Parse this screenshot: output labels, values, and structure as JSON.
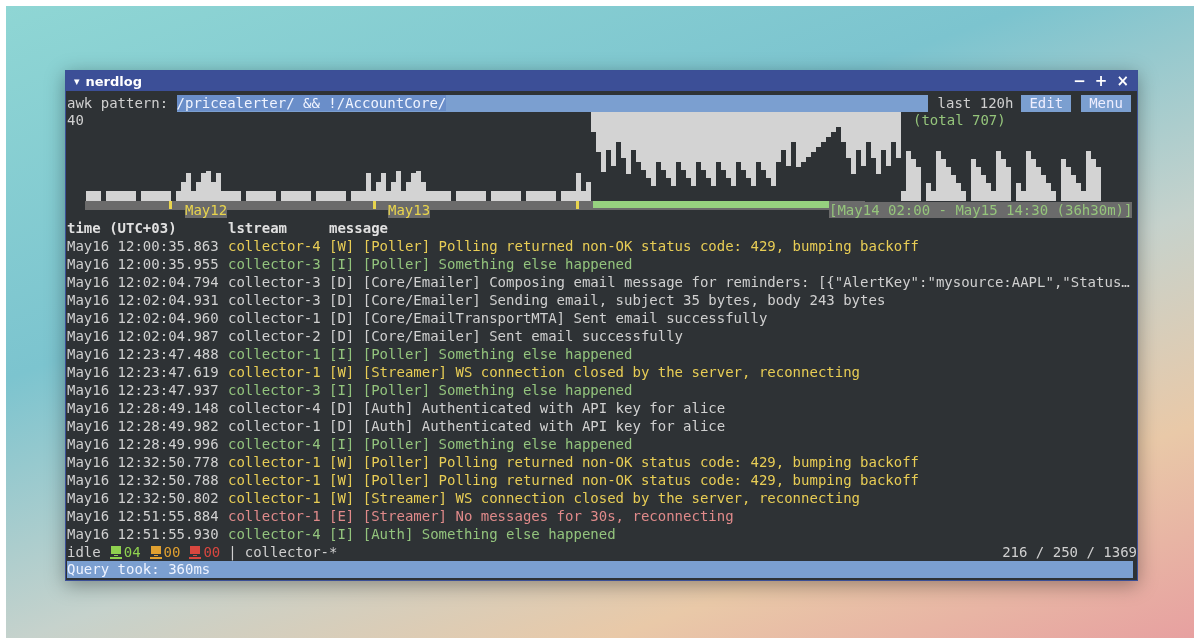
{
  "window": {
    "menu_glyph": "▾",
    "title": "nerdlog",
    "controls": [
      "−",
      "+",
      "×"
    ]
  },
  "query": {
    "label": "awk pattern:",
    "value": "/pricealerter/ && !/AccountCore/",
    "period": "last 120h",
    "buttons": [
      "Edit",
      "Menu"
    ]
  },
  "histogram": {
    "max_label": "40",
    "total": "(total 707)",
    "day_labels": [
      "May12",
      "May13"
    ],
    "selection": "[May14 02:00 - May15 14:30 (36h30m)]"
  },
  "columns": [
    "time (UTC+03)",
    "lstream",
    "message"
  ],
  "rows": [
    {
      "time": "May16 12:00:35.863",
      "lstream": "collector-4",
      "tag": "[W]",
      "message": "[Poller] Polling returned non-OK status code: 429, bumping backoff",
      "kind": "warning"
    },
    {
      "time": "May16 12:00:35.955",
      "lstream": "collector-3",
      "tag": "[I]",
      "message": "[Poller] Something else happened",
      "kind": "info"
    },
    {
      "time": "May16 12:02:04.794",
      "lstream": "collector-3",
      "tag": "[D]",
      "message": "[Core/Emailer] Composing email message for reminders: [{\"AlertKey\":\"mysource:AAPL\",\"Status…",
      "kind": "debug"
    },
    {
      "time": "May16 12:02:04.931",
      "lstream": "collector-3",
      "tag": "[D]",
      "message": "[Core/Emailer] Sending email, subject 35 bytes, body 243 bytes",
      "kind": "debug"
    },
    {
      "time": "May16 12:02:04.960",
      "lstream": "collector-1",
      "tag": "[D]",
      "message": "[Core/EmailTransportMTA] Sent email successfully",
      "kind": "debug"
    },
    {
      "time": "May16 12:02:04.987",
      "lstream": "collector-2",
      "tag": "[D]",
      "message": "[Core/Emailer] Sent email successfully",
      "kind": "debug"
    },
    {
      "time": "May16 12:23:47.488",
      "lstream": "collector-1",
      "tag": "[I]",
      "message": "[Poller] Something else happened",
      "kind": "info"
    },
    {
      "time": "May16 12:23:47.619",
      "lstream": "collector-1",
      "tag": "[W]",
      "message": "[Streamer] WS connection closed by the server, reconnecting",
      "kind": "warning"
    },
    {
      "time": "May16 12:23:47.937",
      "lstream": "collector-3",
      "tag": "[I]",
      "message": "[Poller] Something else happened",
      "kind": "info"
    },
    {
      "time": "May16 12:28:49.148",
      "lstream": "collector-4",
      "tag": "[D]",
      "message": "[Auth] Authenticated with API key for alice",
      "kind": "debug"
    },
    {
      "time": "May16 12:28:49.982",
      "lstream": "collector-1",
      "tag": "[D]",
      "message": "[Auth] Authenticated with API key for alice",
      "kind": "debug"
    },
    {
      "time": "May16 12:28:49.996",
      "lstream": "collector-4",
      "tag": "[I]",
      "message": "[Poller] Something else happened",
      "kind": "info"
    },
    {
      "time": "May16 12:32:50.778",
      "lstream": "collector-1",
      "tag": "[W]",
      "message": "[Poller] Polling returned non-OK status code: 429, bumping backoff",
      "kind": "warning"
    },
    {
      "time": "May16 12:32:50.788",
      "lstream": "collector-1",
      "tag": "[W]",
      "message": "[Poller] Polling returned non-OK status code: 429, bumping backoff",
      "kind": "warning"
    },
    {
      "time": "May16 12:32:50.802",
      "lstream": "collector-1",
      "tag": "[W]",
      "message": "[Streamer] WS connection closed by the server, reconnecting",
      "kind": "warning"
    },
    {
      "time": "May16 12:51:55.884",
      "lstream": "collector-1",
      "tag": "[E]",
      "message": "[Streamer] No messages for 30s, reconnecting",
      "kind": "error"
    },
    {
      "time": "May16 12:51:55.930",
      "lstream": "collector-4",
      "tag": "[I]",
      "message": "[Auth] Something else happened",
      "kind": "info"
    }
  ],
  "status_bar": {
    "state": "idle",
    "hosts": [
      {
        "count": "04",
        "color": "#8fd14f"
      },
      {
        "count": "00",
        "color": "#e0a030"
      },
      {
        "count": "00",
        "color": "#d9473f"
      }
    ],
    "separator": "|",
    "filter": "collector-*",
    "counts": "216 / 250 / 1369"
  },
  "message_bar": "Query took: 360ms"
}
